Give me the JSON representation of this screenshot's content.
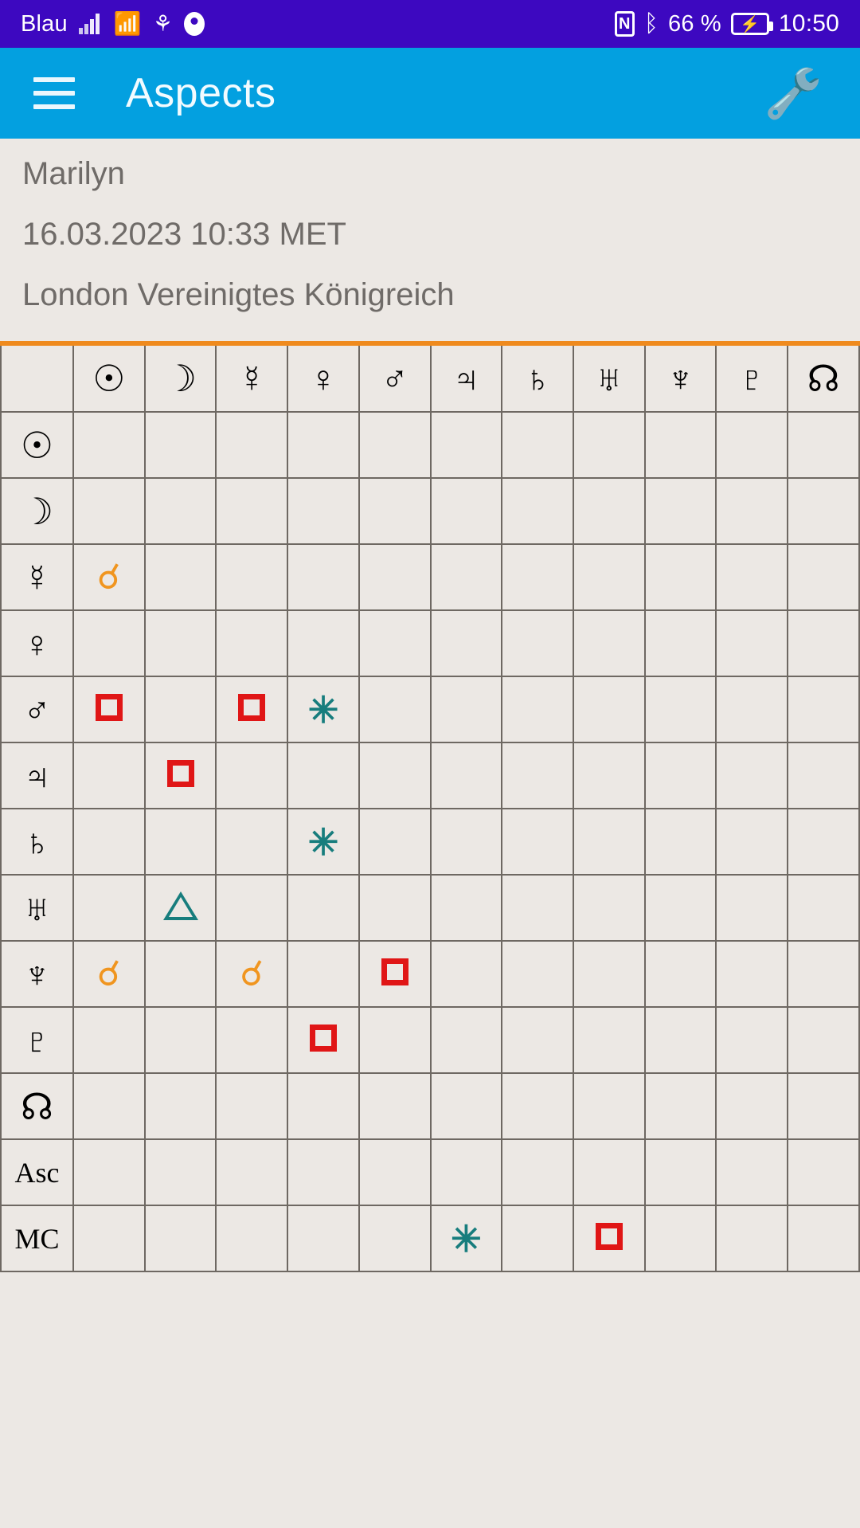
{
  "statusbar": {
    "carrier": "Blau",
    "icons": [
      "signal-icon",
      "wifi-icon",
      "usb-icon",
      "eye-icon"
    ],
    "nfc": "N",
    "bluetooth": "ᛒ",
    "battery_percent": "66 %",
    "battery_state": "charging",
    "time": "10:50"
  },
  "appbar": {
    "menu": "menu-icon",
    "title": "Aspects",
    "action": "wrench-icon"
  },
  "info": {
    "name": "Marilyn",
    "datetime": "16.03.2023 10:33 MET",
    "location": "London Vereinigtes Königreich"
  },
  "accent_color": "#ef8a1d",
  "legend": {
    "conjunction_color": "#f0951f",
    "square_color": "#e01616",
    "sextile_color": "#177d7d",
    "trine_color": "#177d7d"
  },
  "table": {
    "columns": [
      {
        "key": "sun",
        "glyph": "☉",
        "name": "sun"
      },
      {
        "key": "moon",
        "glyph": "☽",
        "name": "moon"
      },
      {
        "key": "mercury",
        "glyph": "☿",
        "name": "mercury"
      },
      {
        "key": "venus",
        "glyph": "♀",
        "name": "venus"
      },
      {
        "key": "mars",
        "glyph": "♂",
        "name": "mars"
      },
      {
        "key": "jupiter",
        "glyph": "♃",
        "name": "jupiter"
      },
      {
        "key": "saturn",
        "glyph": "♄",
        "name": "saturn"
      },
      {
        "key": "uranus",
        "glyph": "♅",
        "name": "uranus"
      },
      {
        "key": "neptune",
        "glyph": "♆",
        "name": "neptune"
      },
      {
        "key": "pluto",
        "glyph": "♇",
        "name": "pluto"
      },
      {
        "key": "node",
        "glyph": "☊",
        "name": "north-node"
      }
    ],
    "rows": [
      {
        "key": "sun",
        "glyph": "☉",
        "text": null,
        "cells": [
          null,
          null,
          null,
          null,
          null,
          null,
          null,
          null,
          null,
          null,
          null
        ]
      },
      {
        "key": "moon",
        "glyph": "☽",
        "text": null,
        "cells": [
          null,
          null,
          null,
          null,
          null,
          null,
          null,
          null,
          null,
          null,
          null
        ]
      },
      {
        "key": "mercury",
        "glyph": "☿",
        "text": null,
        "cells": [
          "conjunction",
          null,
          null,
          null,
          null,
          null,
          null,
          null,
          null,
          null,
          null
        ]
      },
      {
        "key": "venus",
        "glyph": "♀",
        "text": null,
        "cells": [
          null,
          null,
          null,
          null,
          null,
          null,
          null,
          null,
          null,
          null,
          null
        ]
      },
      {
        "key": "mars",
        "glyph": "♂",
        "text": null,
        "cells": [
          "square",
          null,
          "square",
          "sextile",
          null,
          null,
          null,
          null,
          null,
          null,
          null
        ]
      },
      {
        "key": "jupiter",
        "glyph": "♃",
        "text": null,
        "cells": [
          null,
          "square",
          null,
          null,
          null,
          null,
          null,
          null,
          null,
          null,
          null
        ]
      },
      {
        "key": "saturn",
        "glyph": "♄",
        "text": null,
        "cells": [
          null,
          null,
          null,
          "sextile",
          null,
          null,
          null,
          null,
          null,
          null,
          null
        ]
      },
      {
        "key": "uranus",
        "glyph": "♅",
        "text": null,
        "cells": [
          null,
          "trine",
          null,
          null,
          null,
          null,
          null,
          null,
          null,
          null,
          null
        ]
      },
      {
        "key": "neptune",
        "glyph": "♆",
        "text": null,
        "cells": [
          "conjunction",
          null,
          "conjunction",
          null,
          "square",
          null,
          null,
          null,
          null,
          null,
          null
        ]
      },
      {
        "key": "pluto",
        "glyph": "♇",
        "text": null,
        "cells": [
          null,
          null,
          null,
          "square",
          null,
          null,
          null,
          null,
          null,
          null,
          null
        ]
      },
      {
        "key": "node",
        "glyph": "☊",
        "text": null,
        "cells": [
          null,
          null,
          null,
          null,
          null,
          null,
          null,
          null,
          null,
          null,
          null
        ]
      },
      {
        "key": "asc",
        "glyph": null,
        "text": "Asc",
        "cells": [
          null,
          null,
          null,
          null,
          null,
          null,
          null,
          null,
          null,
          null,
          null
        ]
      },
      {
        "key": "mc",
        "glyph": null,
        "text": "MC",
        "cells": [
          null,
          null,
          null,
          null,
          null,
          "sextile",
          null,
          "square",
          null,
          null,
          null
        ]
      }
    ]
  }
}
